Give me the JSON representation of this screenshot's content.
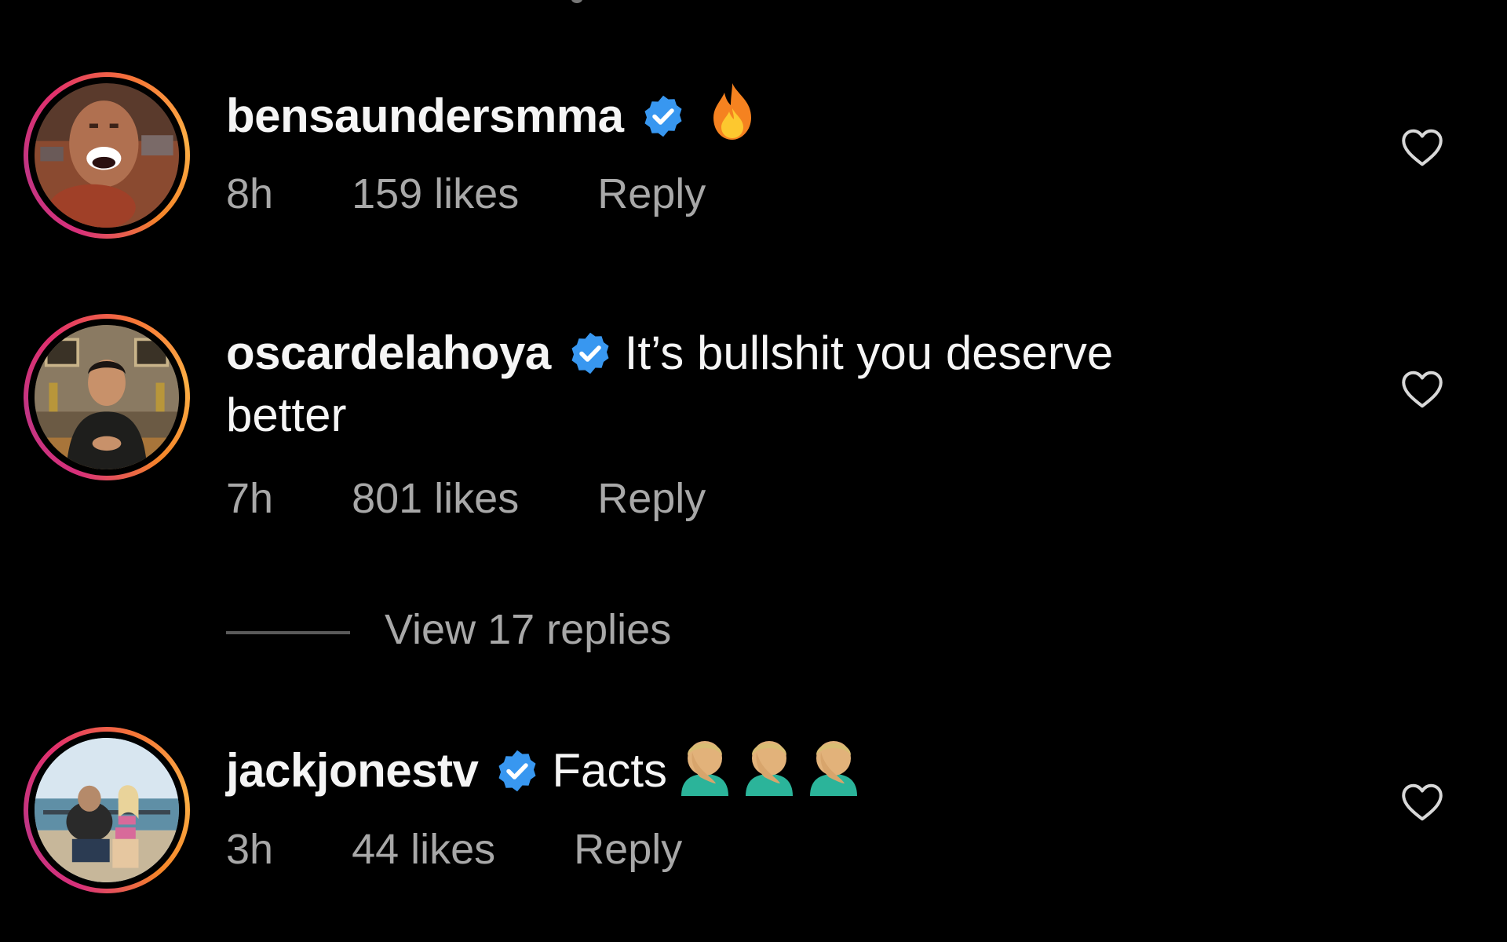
{
  "comments": [
    {
      "username": "bensaundersmma",
      "verified": true,
      "text": "",
      "emoji": "fire-emoji",
      "time": "8h",
      "likes": "159 likes",
      "reply": "Reply"
    },
    {
      "username": "oscardelahoya",
      "verified": true,
      "text": "It’s bullshit you deserve",
      "text_wrap": "better",
      "time": "7h",
      "likes": "801 likes",
      "reply": "Reply",
      "view_replies": "View 17 replies"
    },
    {
      "username": "jackjonestv",
      "verified": true,
      "text": "Facts",
      "emoji": "facepalm-emoji x3",
      "time": "3h",
      "likes": "44 likes",
      "reply": "Reply"
    }
  ],
  "colors": {
    "background": "#000000",
    "primary_text": "#f5f5f5",
    "secondary_text": "#a8a8a8",
    "verified_badge": "#3897f0",
    "story_ring_start": "#d8307a",
    "story_ring_end": "#fcaf45"
  },
  "icons": {
    "like": "heart-outline-icon",
    "verified": "verified-badge-icon"
  }
}
